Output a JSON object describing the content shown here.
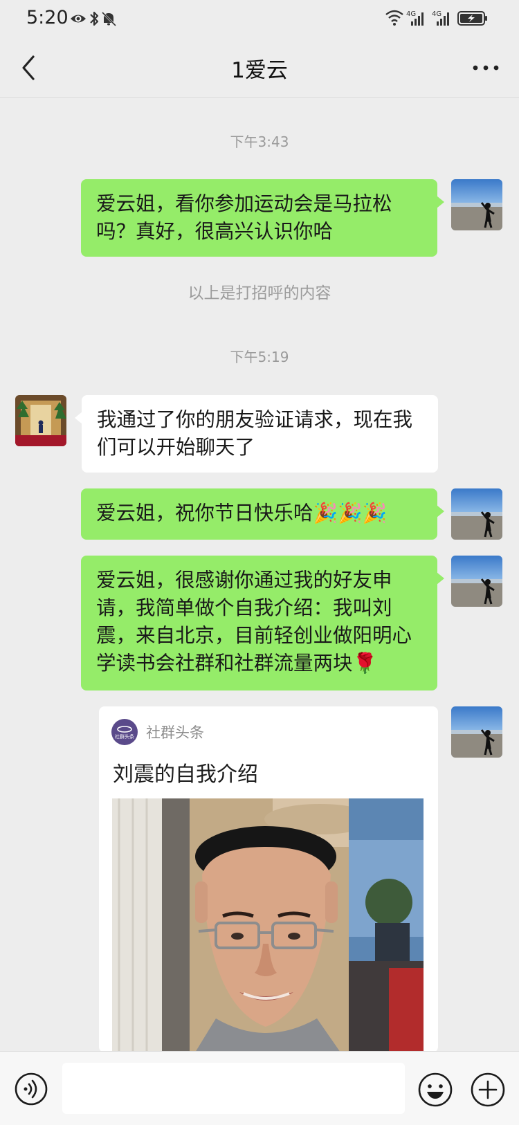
{
  "status_bar": {
    "time": "5:20",
    "left_icons": [
      "eye-icon",
      "bluetooth-icon",
      "mute-bell-icon"
    ],
    "right_icons": [
      "wifi-icon",
      "signal-4g-icon",
      "signal-4g-icon",
      "battery-charging-icon"
    ],
    "network_label_1": "4G",
    "network_label_2": "4G"
  },
  "header": {
    "title": "1爱云",
    "back_icon": "back-chevron-icon",
    "more_icon": "more-dots-icon"
  },
  "chat": {
    "timestamps": [
      "下午3:43",
      "下午5:19"
    ],
    "system_note": "以上是打招呼的内容",
    "messages": [
      {
        "side": "sent",
        "text": "爱云姐，看你参加运动会是马拉松吗？真好，很高兴认识你哈"
      },
      {
        "side": "recv",
        "text": "我通过了你的朋友验证请求，现在我们可以开始聊天了"
      },
      {
        "side": "sent",
        "text": "爱云姐，祝你节日快乐哈🎉🎉🎉"
      },
      {
        "side": "sent",
        "text": "爱云姐，很感谢你通过我的好友申请，我简单做个自我介绍：我叫刘震，来自北京，目前轻创业做阳明心学读书会社群和社群流量两块🌹"
      }
    ],
    "card": {
      "source": "社群头条",
      "logo_text": "社群头条",
      "title": "刘震的自我介绍"
    }
  },
  "input_bar": {
    "value": "",
    "voice_icon": "voice-icon",
    "emoji_icon": "emoji-icon",
    "plus_icon": "plus-icon"
  },
  "colors": {
    "background": "#ededed",
    "sent_bubble": "#95ec69",
    "received_bubble": "#ffffff",
    "meta_text": "#9a9a9a"
  }
}
